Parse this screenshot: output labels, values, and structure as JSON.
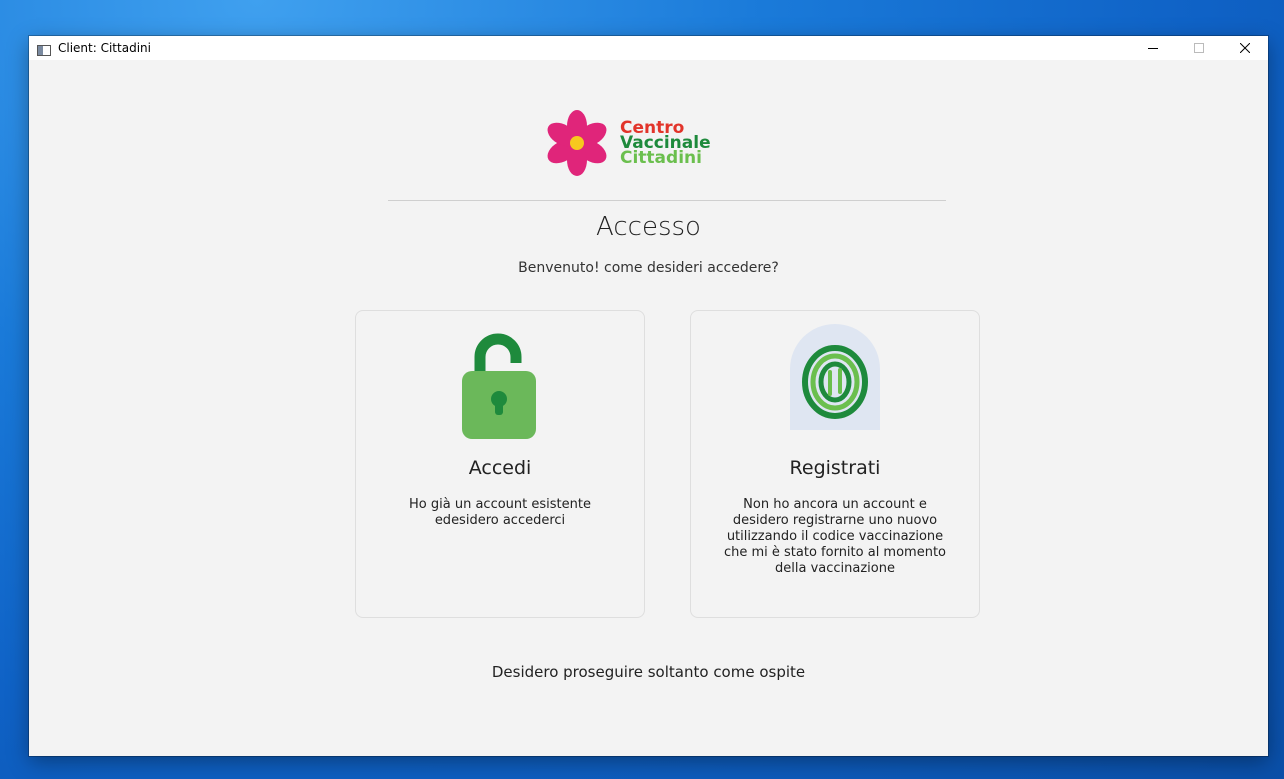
{
  "window": {
    "title": "Client: Cittadini"
  },
  "logo": {
    "line1": "Centro",
    "line2": "Vaccinale",
    "line3": "Cittadini"
  },
  "page": {
    "heading": "Accesso",
    "subheading": "Benvenuto! come desideri accedere?"
  },
  "cards": [
    {
      "title": "Accedi",
      "description": "Ho già un account esistente edesidero accederci",
      "icon": "unlocked-padlock-icon"
    },
    {
      "title": "Registrati",
      "description": "Non ho ancora un account e desidero registrarne uno nuovo utilizzando il codice vaccinazione che mi è stato fornito al momento della vaccinazione",
      "icon": "fingerprint-icon"
    }
  ],
  "guest_link": "Desidero proseguire soltanto come ospite",
  "colors": {
    "lock_green": "#6bb85a",
    "lock_dark": "#1e8a3c",
    "flower_pink": "#e0257a",
    "flower_center": "#f7c81e",
    "fingerprint_bg": "#dfe6f2"
  }
}
